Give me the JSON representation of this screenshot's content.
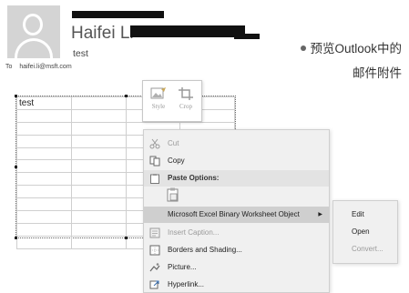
{
  "email": {
    "sender_name": "Haifei Li",
    "subject": "test",
    "to_label": "To",
    "to_address": "haifei.li@msft.com"
  },
  "caption": {
    "line1": "预览Outlook中的",
    "line2": "邮件附件"
  },
  "sheet": {
    "cell_a1": "test",
    "rows": 12,
    "cols": 4
  },
  "mini_toolbar": {
    "style_label": "Style",
    "crop_label": "Crop"
  },
  "context_menu": {
    "items": [
      {
        "label": "Cut",
        "icon": "scissors-icon",
        "state": "disabled"
      },
      {
        "label": "Copy",
        "icon": "copy-icon",
        "state": "enabled"
      },
      {
        "label": "Paste Options:",
        "icon": "clipboard-icon",
        "state": "header"
      },
      {
        "label": "Microsoft Excel Binary Worksheet Object",
        "state": "selected",
        "has_submenu": true
      },
      {
        "label": "Insert Caption...",
        "icon": "caption-icon",
        "state": "disabled"
      },
      {
        "label": "Borders and Shading...",
        "icon": "borders-icon",
        "state": "enabled"
      },
      {
        "label": "Picture...",
        "icon": "picture-icon",
        "state": "enabled"
      },
      {
        "label": "Hyperlink...",
        "icon": "hyperlink-icon",
        "state": "enabled"
      }
    ],
    "submenu": [
      {
        "label": "Edit",
        "state": "enabled"
      },
      {
        "label": "Open",
        "state": "enabled"
      },
      {
        "label": "Convert...",
        "state": "disabled"
      }
    ]
  },
  "colors": {
    "menu_bg": "#f0f0f0",
    "menu_selected": "#cfcfcf",
    "disabled_text": "#9a9a9a"
  }
}
